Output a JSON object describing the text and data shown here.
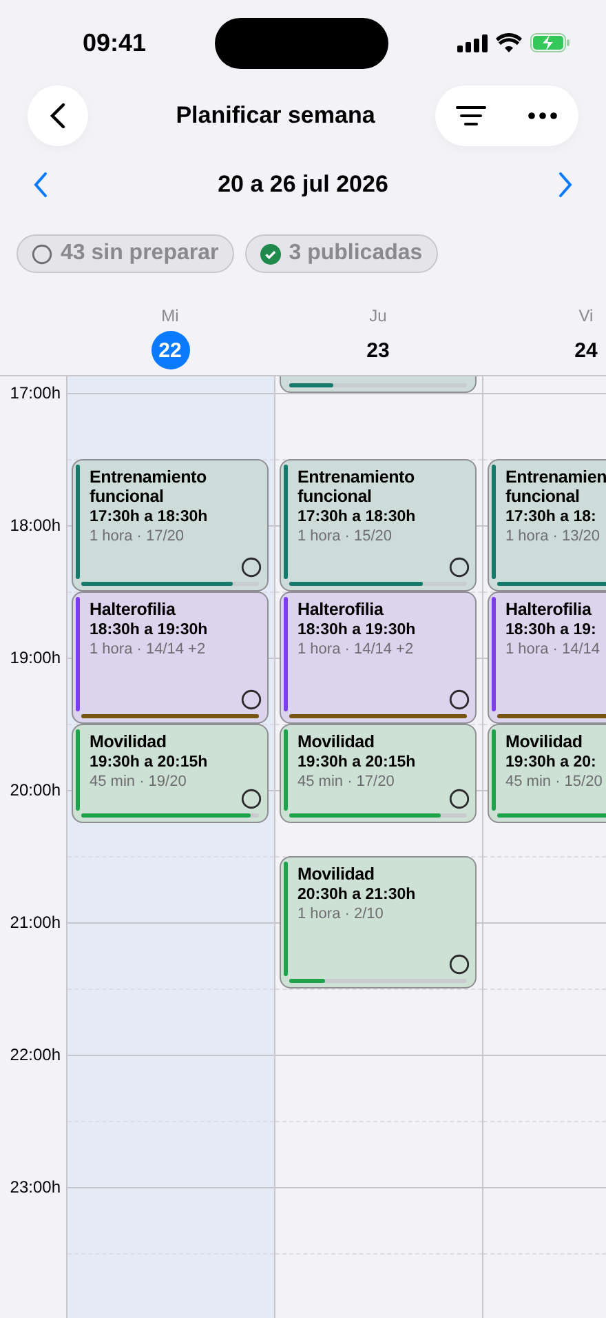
{
  "status_bar": {
    "time": "09:41"
  },
  "nav": {
    "title": "Planificar semana"
  },
  "week": {
    "label": "20 a 26 jul 2026"
  },
  "chips": [
    {
      "label": "43 sin preparar",
      "kind": "pending"
    },
    {
      "label": "3 publicadas",
      "kind": "published"
    }
  ],
  "hours": [
    "17:00h",
    "18:00h",
    "19:00h",
    "20:00h",
    "21:00h",
    "22:00h",
    "23:00h"
  ],
  "days": [
    {
      "weekday": "Mi",
      "date": "22",
      "selected": true,
      "events": [
        {
          "kind": "event",
          "title": "Entrenamiento funcional",
          "time": "17:30h a 18:30h",
          "meta": "1 hora · 17/20",
          "color": "#137a6c",
          "level": 0.85,
          "published": false
        },
        {
          "kind": "event",
          "title": "Halterofilia",
          "time": "18:30h a 19:30h",
          "meta": "1 hora · 14/14 +2",
          "color": "#7d3cf0",
          "level": 1,
          "published": false
        },
        {
          "kind": "event",
          "title": "Movilidad",
          "time": "19:30h a 20:15h",
          "meta": "45 min · 19/20",
          "color": "#1ea34b",
          "level": 0.95,
          "published": false
        }
      ]
    },
    {
      "weekday": "Ju",
      "date": "23",
      "selected": false,
      "events": [
        {
          "kind": "clipped",
          "color": "#137a6c",
          "level": 0.25
        },
        {
          "kind": "event",
          "title": "Entrenamiento funcional",
          "time": "17:30h a 18:30h",
          "meta": "1 hora · 15/20",
          "color": "#137a6c",
          "level": 0.75,
          "published": false
        },
        {
          "kind": "event",
          "title": "Halterofilia",
          "time": "18:30h a 19:30h",
          "meta": "1 hora · 14/14 +2",
          "color": "#7d3cf0",
          "level": 1,
          "published": false
        },
        {
          "kind": "event",
          "title": "Movilidad",
          "time": "19:30h a 20:15h",
          "meta": "45 min · 17/20",
          "color": "#1ea34b",
          "level": 0.85,
          "published": false
        },
        {
          "kind": "event",
          "title": "Movilidad",
          "time": "20:30h a 21:30h",
          "meta": "1 hora · 2/10",
          "color": "#1ea34b",
          "level": 0.2,
          "published": false
        }
      ]
    },
    {
      "weekday": "Vi",
      "date": "24",
      "selected": false,
      "events": [
        {
          "kind": "event",
          "title": "Entrenamien funcional",
          "time": "17:30h a 18:",
          "meta": "1 hora · 13/20",
          "color": "#137a6c",
          "level": 0.65
        },
        {
          "kind": "event",
          "title": "Halterofilia",
          "time": "18:30h a 19:",
          "meta": "1 hora · 14/14",
          "color": "#7d3cf0",
          "level": 1
        },
        {
          "kind": "event",
          "title": "Movilidad",
          "time": "19:30h a 20:",
          "meta": "45 min · 15/20",
          "color": "#1ea34b",
          "level": 0.75
        }
      ]
    }
  ]
}
